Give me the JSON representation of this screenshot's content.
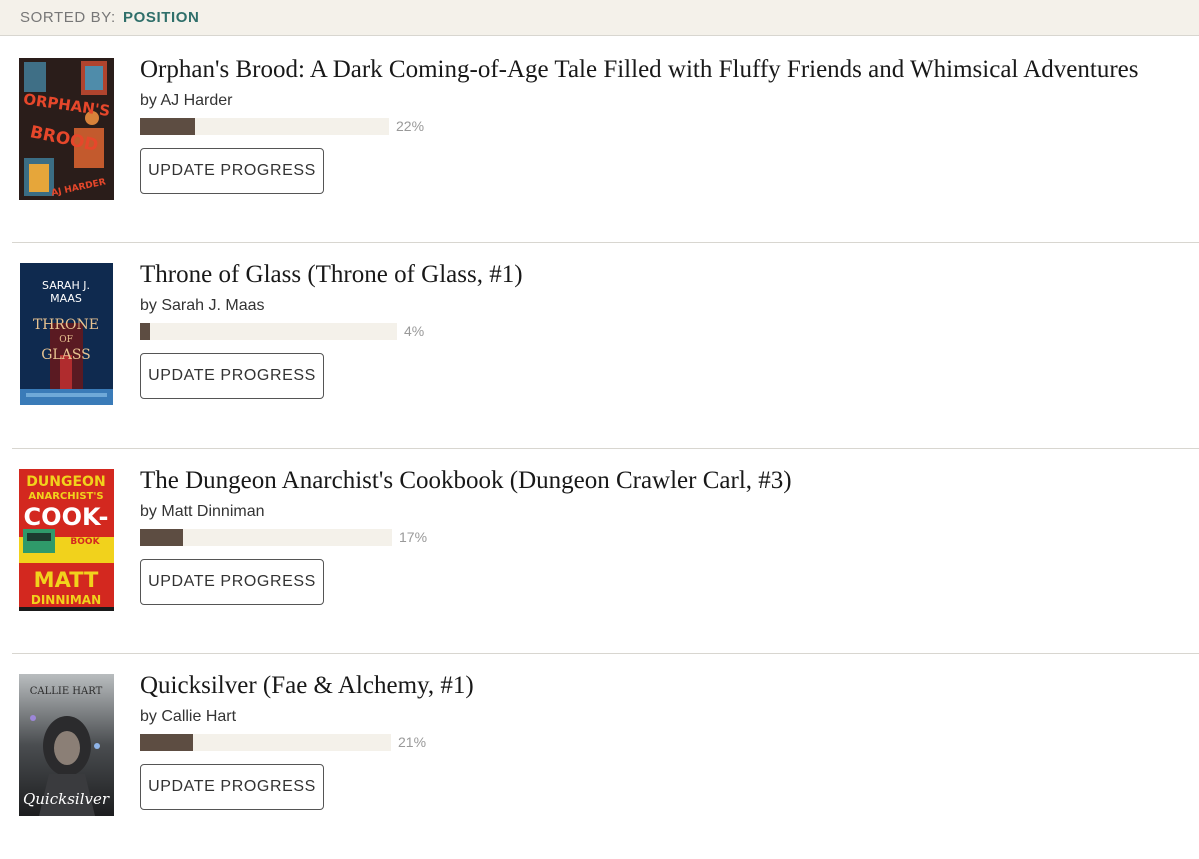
{
  "sort": {
    "label": "SORTED BY:",
    "value": "POSITION"
  },
  "books": [
    {
      "title": "Orphan's Brood: A Dark Coming-of-Age Tale Filled with Fluffy Friends and Whimsical Adventures",
      "author_prefix": "by",
      "author": "AJ Harder",
      "progress": 22,
      "progress_label": "22%",
      "button_label": "UPDATE PROGRESS",
      "cover_text": [
        "ORPHAN'S",
        "BROOD",
        "AJ HARDER"
      ],
      "cover_colors": [
        "#2a1d1a",
        "#e6472b"
      ]
    },
    {
      "title": "Throne of Glass (Throne of Glass, #1)",
      "author_prefix": "by",
      "author": "Sarah J. Maas",
      "progress": 4,
      "progress_label": "4%",
      "button_label": "UPDATE PROGRESS",
      "cover_text": [
        "SARAH J.",
        "MAAS",
        "THRONE",
        "OF",
        "GLASS"
      ],
      "cover_colors": [
        "#0f2a4f",
        "#e8c391"
      ]
    },
    {
      "title": "The Dungeon Anarchist's Cookbook (Dungeon Crawler Carl, #3)",
      "author_prefix": "by",
      "author": "Matt Dinniman",
      "progress": 17,
      "progress_label": "17%",
      "button_label": "UPDATE PROGRESS",
      "cover_text": [
        "DUNGEON",
        "ANARCHIST'S",
        "COOK-",
        "BOOK",
        "MATT",
        "DINNIMAN"
      ],
      "cover_colors": [
        "#d3281f",
        "#f1d21c"
      ]
    },
    {
      "title": "Quicksilver (Fae & Alchemy, #1)",
      "author_prefix": "by",
      "author": "Callie Hart",
      "progress": 21,
      "progress_label": "21%",
      "button_label": "UPDATE PROGRESS",
      "cover_text": [
        "CALLIE HART",
        "Quicksilver"
      ],
      "cover_colors": [
        "#2c2e30",
        "#c9ccd0"
      ]
    }
  ]
}
